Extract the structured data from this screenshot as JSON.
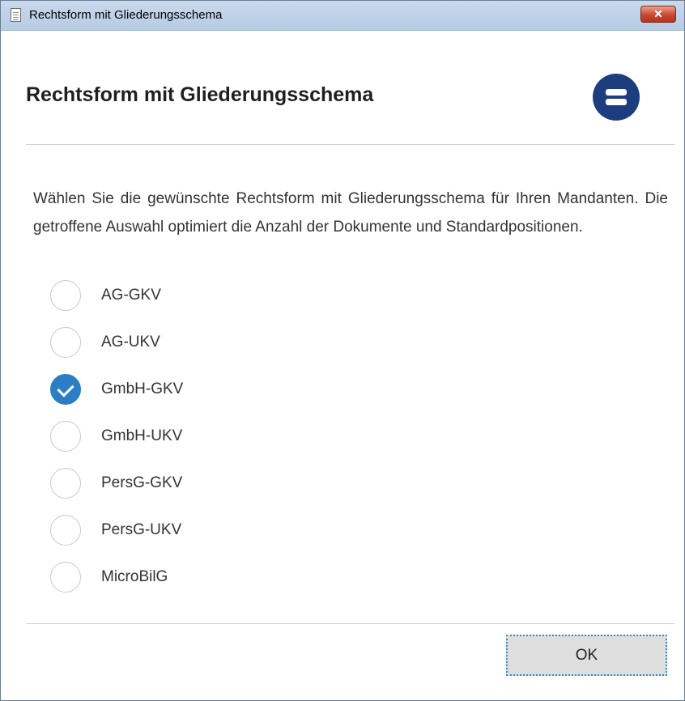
{
  "window": {
    "title": "Rechtsform mit Gliederungsschema",
    "close_label": "✕"
  },
  "dialog": {
    "heading": "Rechtsform mit Gliederungsschema",
    "description": "Wählen Sie die gewünschte Rechtsform mit Gliederungsschema für Ihren Mandanten. Die getroffene Auswahl optimiert die Anzahl der Dokumente und Standardpositionen.",
    "menu_icon": "menu-equals-icon",
    "options": [
      {
        "label": "AG-GKV",
        "checked": false
      },
      {
        "label": "AG-UKV",
        "checked": false
      },
      {
        "label": "GmbH-GKV",
        "checked": true
      },
      {
        "label": "GmbH-UKV",
        "checked": false
      },
      {
        "label": "PersG-GKV",
        "checked": false
      },
      {
        "label": "PersG-UKV",
        "checked": false
      },
      {
        "label": "MicroBilG",
        "checked": false
      }
    ],
    "ok_label": "OK"
  },
  "colors": {
    "accent": "#2b7ec4",
    "menu_icon": "#1c3d7e",
    "close_button": "#c9482f"
  }
}
